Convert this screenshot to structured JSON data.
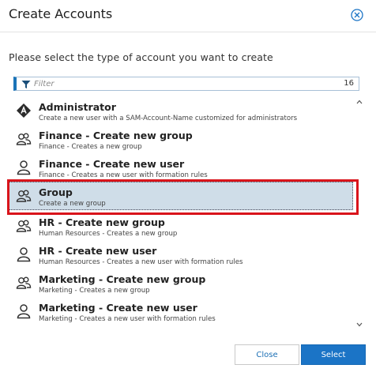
{
  "dialog": {
    "title": "Create Accounts",
    "prompt": "Please select the type of account you want to create"
  },
  "filter": {
    "placeholder": "Filter",
    "count": "16"
  },
  "items": [
    {
      "name": "Administrator",
      "desc": "Create a new user with a SAM-Account-Name customized for administrators",
      "icon": "admin-icon"
    },
    {
      "name": "Finance - Create new group",
      "desc": "Finance - Creates a new group",
      "icon": "group-icon"
    },
    {
      "name": "Finance - Create new user",
      "desc": "Finance - Creates a new user with formation rules",
      "icon": "user-icon"
    },
    {
      "name": "Group",
      "desc": "Create a new group",
      "icon": "group-icon",
      "selected": true
    },
    {
      "name": "HR - Create new group",
      "desc": "Human Resources - Creates a new group",
      "icon": "group-icon"
    },
    {
      "name": "HR - Create new user",
      "desc": "Human Resources - Creates a new user with formation rules",
      "icon": "user-icon"
    },
    {
      "name": "Marketing - Create new group",
      "desc": "Marketing - Creates a new group",
      "icon": "group-icon"
    },
    {
      "name": "Marketing - Create new user",
      "desc": "Marketing - Creates a new user with formation rules",
      "icon": "user-icon"
    }
  ],
  "buttons": {
    "close_label": "Close",
    "select_label": "Select"
  },
  "colors": {
    "accent": "#1b74c6",
    "selection": "#cfdde8",
    "highlight": "#d9141b"
  }
}
